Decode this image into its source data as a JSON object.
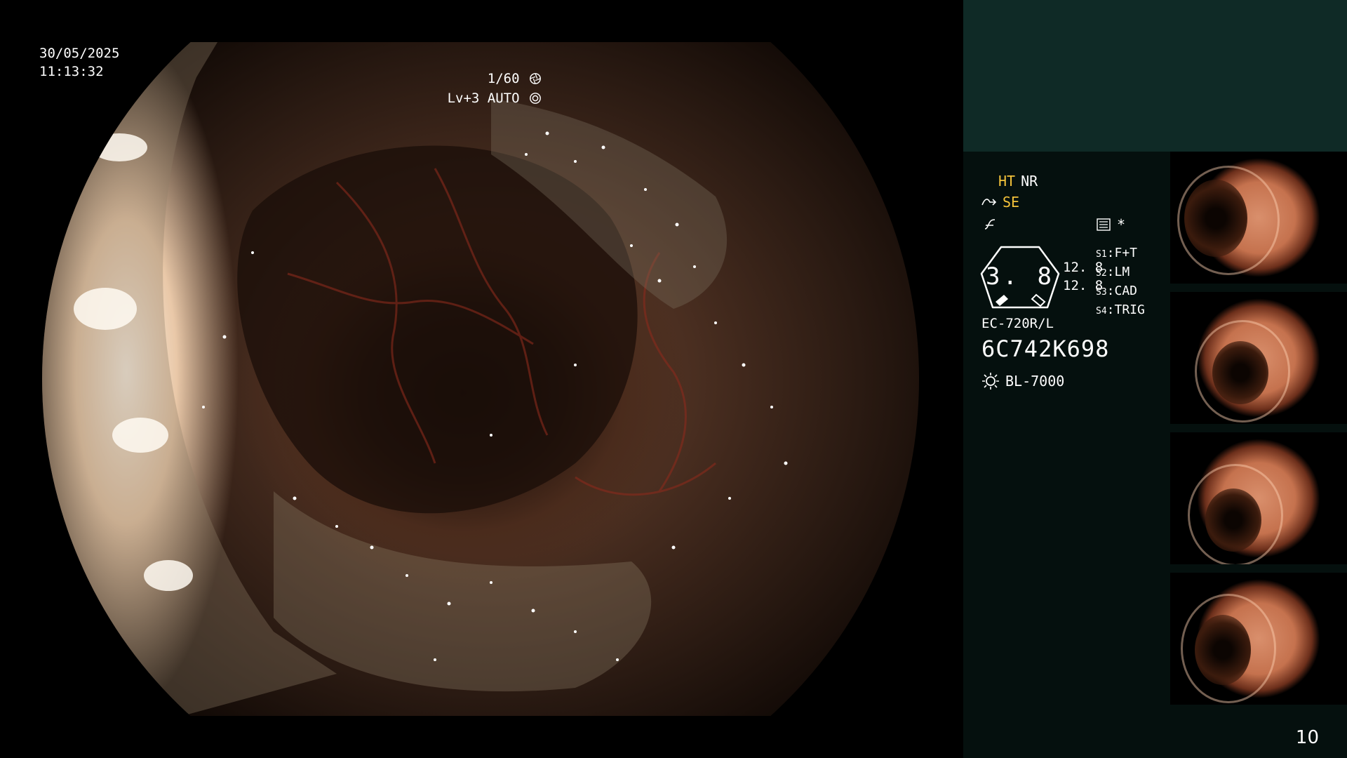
{
  "overlay": {
    "date": "30/05/2025",
    "time": "11:13:32",
    "shutter": "1/60",
    "light_level": "Lv+3",
    "mode": "AUTO"
  },
  "status": {
    "ht": "HT",
    "nr": "NR",
    "se": "SE",
    "star": "*",
    "gauge_value": "3. 8",
    "gauge_sub_1": "12. 8",
    "gauge_sub_2": "12. 8",
    "settings": [
      {
        "key": "S1",
        "value": "F+T"
      },
      {
        "key": "S2",
        "value": "LM"
      },
      {
        "key": "S3",
        "value": "CAD"
      },
      {
        "key": "S4",
        "value": "TRIG"
      }
    ],
    "model": "EC-720R/L",
    "serial": "6C742K698",
    "light_source": "BL-7000"
  },
  "colors": {
    "status_yellow": "#f3c23a",
    "panel_top": "#0f2a26",
    "panel_bottom": "#05100e"
  },
  "icons": [
    "shutter-icon",
    "auto-icon",
    "scope-tip-icon",
    "freeze-icon",
    "settings-icon",
    "light-source-icon"
  ],
  "page_number": "10"
}
